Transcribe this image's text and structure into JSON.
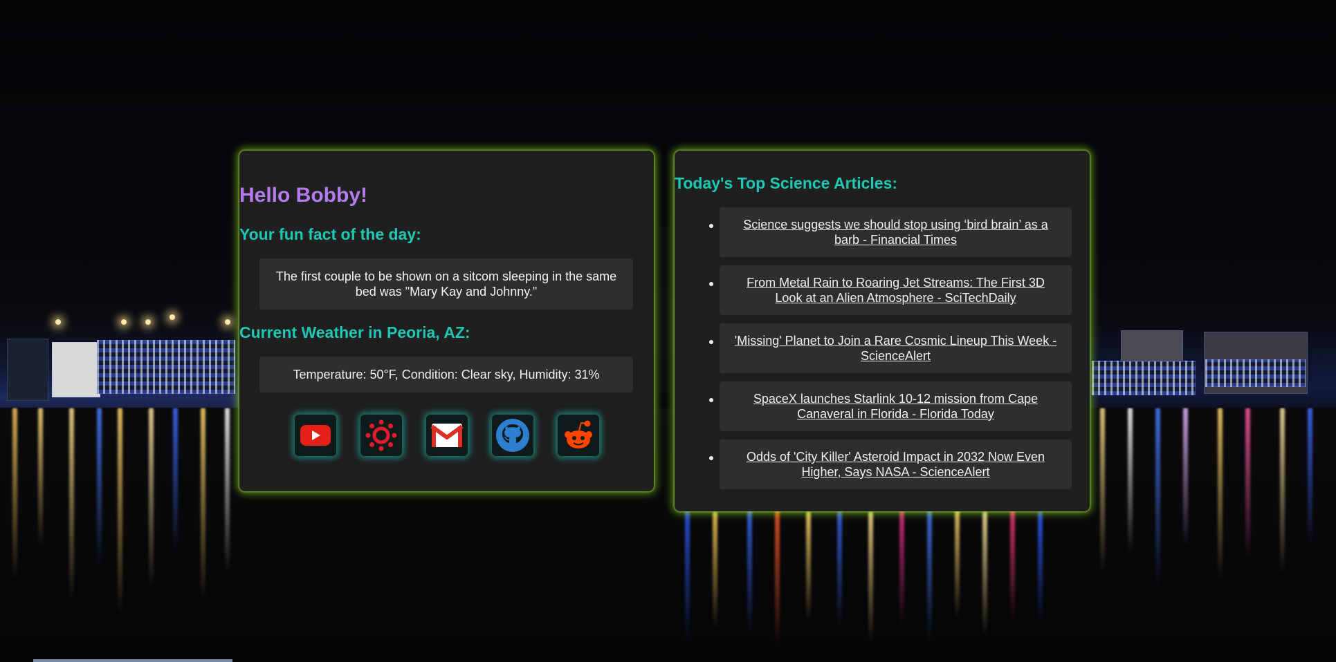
{
  "greeting": "Hello Bobby!",
  "fun_fact": {
    "heading": "Your fun fact of the day:",
    "text": "The first couple to be shown on a sitcom sleeping in the same bed was \"Mary Kay and Johnny.\""
  },
  "weather": {
    "heading": "Current Weather in Peoria, AZ:",
    "text": "Temperature: 50°F, Condition: Clear sky, Humidity: 31%"
  },
  "quick_links": [
    {
      "name": "youtube-icon",
      "color": "#e62117"
    },
    {
      "name": "canvas-icon",
      "color": "#e21b2d"
    },
    {
      "name": "gmail-icon",
      "color": "#d93025"
    },
    {
      "name": "github-icon",
      "color": "#2f7fd0"
    },
    {
      "name": "reddit-icon",
      "color": "#ff4500"
    }
  ],
  "articles": {
    "heading": "Today's Top Science Articles:",
    "items": [
      {
        "title": "Science suggests we should stop using ‘bird brain’ as a barb - Financial Times"
      },
      {
        "title": "From Metal Rain to Roaring Jet Streams: The First 3D Look at an Alien Atmosphere - SciTechDaily"
      },
      {
        "title": "'Missing' Planet to Join a Rare Cosmic Lineup This Week - ScienceAlert"
      },
      {
        "title": "SpaceX launches Starlink 10-12 mission from Cape Canaveral in Florida - Florida Today"
      },
      {
        "title": "Odds of 'City Killer' Asteroid Impact in 2032 Now Even Higher, Says NASA - ScienceAlert"
      }
    ]
  },
  "colors": {
    "greeting": "#b57cf0",
    "heading": "#1ec8b4",
    "card_glow": "#aaff28",
    "card_bg": "#1f1f1f",
    "box_bg": "#2e2e2e"
  }
}
